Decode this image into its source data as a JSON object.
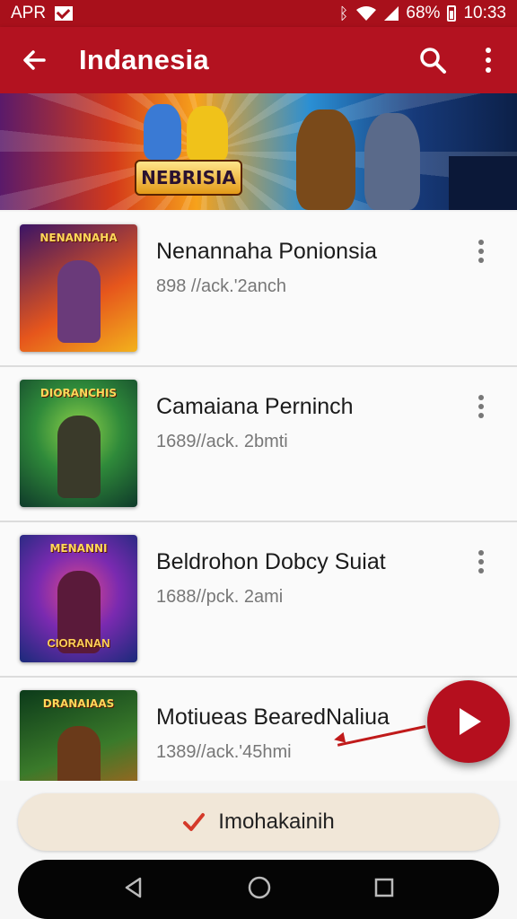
{
  "status_bar": {
    "carrier": "APR",
    "battery": "68%",
    "time": "10:33"
  },
  "app_bar": {
    "title": "Indanesia",
    "icons": [
      "back-arrow-icon",
      "search-icon",
      "more-vert-icon"
    ]
  },
  "banner": {
    "logo_text": "NEBRISIA"
  },
  "list": {
    "items": [
      {
        "title": "Nenannaha Ponionsia",
        "subtitle": "898 //ack.'2anch",
        "thumb_label": "NENANNAHA",
        "thumb_sub": "",
        "colors": [
          "#3a1466",
          "#e6561c",
          "#f3b21c"
        ]
      },
      {
        "title": "Camaiana Perninch",
        "subtitle": "1689//ack. 2bmti",
        "thumb_label": "DIORANCHIS",
        "thumb_sub": "",
        "colors": [
          "#0f3a2a",
          "#2f8a3a",
          "#8fd24a"
        ]
      },
      {
        "title": "Beldrohon Dobcy Suiat",
        "subtitle": "1688//pck. 2ami",
        "thumb_label": "MENANNI",
        "thumb_sub": "CIORANAN",
        "colors": [
          "#1a2a7a",
          "#7a2ab0",
          "#e24a8a"
        ]
      },
      {
        "title": "Motiueas BearedNaliua",
        "subtitle": "1389//ack.'45hmi",
        "thumb_label": "DRANAIAAS",
        "thumb_sub": "",
        "colors": [
          "#0c3a1a",
          "#3a7a2a",
          "#d45a1a"
        ]
      }
    ]
  },
  "fab": {
    "icon": "play-icon"
  },
  "bottom": {
    "confirm_label": "Imohakainih",
    "confirm_icon": "check-icon"
  },
  "nav": {
    "icons": [
      "nav-back-icon",
      "nav-home-icon",
      "nav-recents-icon"
    ]
  },
  "colors": {
    "primary": "#b31220",
    "status_bar": "#a8101b",
    "confirm_bg": "#f1e7d8",
    "check": "#d43a2a"
  }
}
